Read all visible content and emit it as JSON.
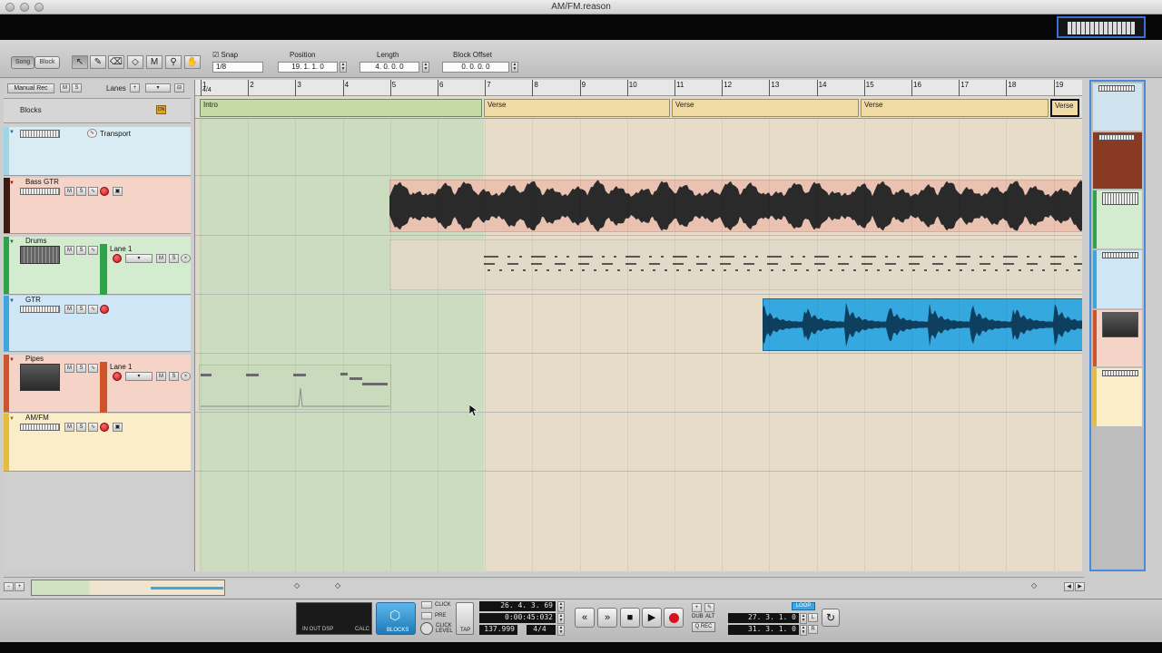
{
  "window": {
    "title": "AM/FM.reason"
  },
  "toolbar": {
    "song_label": "Song",
    "block_label": "Block",
    "snap_label": "Snap",
    "snap_value": "1/8",
    "position_label": "Position",
    "position_value": "19. 1. 1.   0",
    "length_label": "Length",
    "length_value": "4. 0. 0.   0",
    "block_offset_label": "Block Offset",
    "block_offset_value": "0. 0. 0.   0"
  },
  "track_header": {
    "manual_rec": "Manual Rec",
    "m": "M",
    "s": "S",
    "lanes": "Lanes",
    "blocks": "Blocks",
    "on": "ON"
  },
  "tracks": [
    {
      "name": "Transport",
      "color": "#9fd6e6"
    },
    {
      "name": "Bass GTR",
      "color": "#e8846a"
    },
    {
      "name": "Drums",
      "color": "#2fa34a",
      "lane": "Lane 1"
    },
    {
      "name": "GTR",
      "color": "#3ea6dc"
    },
    {
      "name": "Pipes",
      "color": "#d0542a",
      "lane": "Lane 1"
    },
    {
      "name": "AM/FM",
      "color": "#e6bc3c"
    }
  ],
  "ruler": {
    "signature": "4/4",
    "bars": [
      "1",
      "2",
      "3",
      "4",
      "5",
      "6",
      "7",
      "8",
      "9",
      "10",
      "11",
      "12",
      "13",
      "14",
      "15",
      "16",
      "17",
      "18",
      "19"
    ]
  },
  "blocks_row": [
    {
      "label": "Intro"
    },
    {
      "label": "Verse"
    },
    {
      "label": "Verse"
    },
    {
      "label": "Verse"
    },
    {
      "label": "Verse"
    }
  ],
  "transport": {
    "click_label": "CLICK",
    "pre_label": "PRE",
    "click_level_label": "CLICK LEVEL",
    "tap_label": "TAP",
    "blocks_label": "BLOCKS",
    "in_out_dsp": "IN  OUT  DSP",
    "calc": "CALC",
    "position_bars": "26. 4. 3. 69",
    "position_time": "0:00:45:032",
    "tempo": "137.999",
    "signature": "4/4",
    "dub": "DUB",
    "alt": "ALT",
    "q_rec": "Q REC",
    "loop_label": "LOOP",
    "loop_left": "27. 3. 1.   0",
    "loop_right": "31. 3. 1.   0",
    "l": "L",
    "r": "R"
  }
}
